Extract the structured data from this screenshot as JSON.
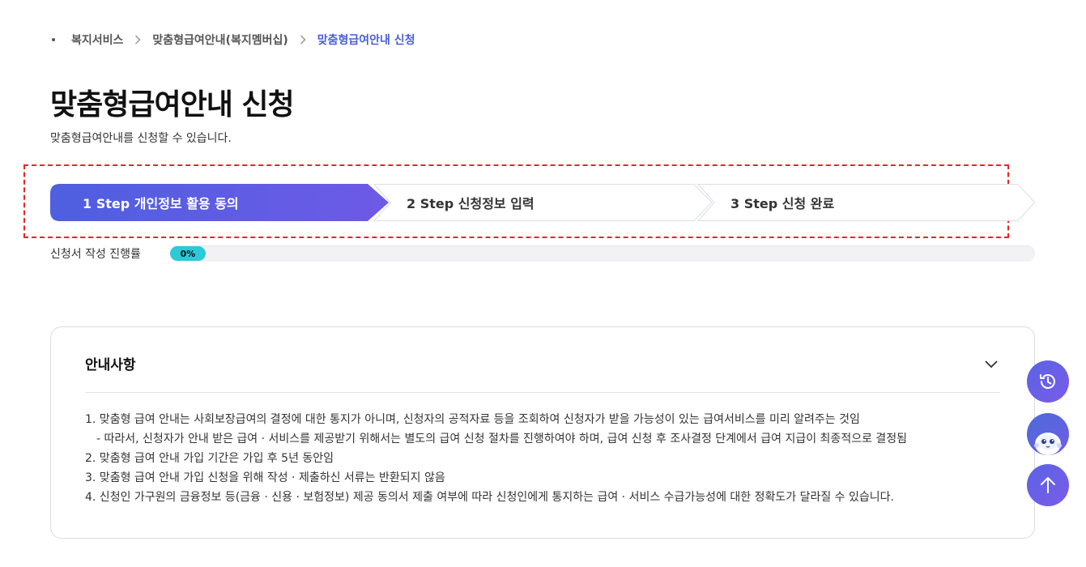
{
  "breadcrumb": {
    "items": [
      {
        "label": "복지서비스"
      },
      {
        "label": "맞춤형급여안내(복지멤버십)"
      },
      {
        "label": "맞춤형급여안내 신청"
      }
    ]
  },
  "page": {
    "title": "맞춤형급여안내 신청",
    "description": "맞춤형급여안내를 신청할 수 있습니다."
  },
  "steps": [
    {
      "label": "1 Step 개인정보 활용 동의",
      "state": "active"
    },
    {
      "label": "2 Step 신청정보 입력",
      "state": "inactive"
    },
    {
      "label": "3 Step 신청 완료",
      "state": "inactive"
    }
  ],
  "progress": {
    "label": "신청서 작성 진행률",
    "value_text": "0%",
    "value": 0
  },
  "notice": {
    "title": "안내사항",
    "toggle_icon": "chevron-down-icon",
    "lines": [
      "1. 맞춤형 급여 안내는 사회보장급여의 결정에 대한 통지가 아니며, 신청자의 공적자료 등을 조회하여 신청자가 받을 가능성이 있는 급여서비스를 미리 알려주는 것임",
      "- 따라서, 신청자가 안내 받은 급여 · 서비스를 제공받기 위해서는 별도의 급여 신청 절차를 진행하여야 하며, 급여 신청 후 조사결정 단계에서 급여 지급이 최종적으로 결정됨",
      "2. 맞춤형 급여 안내 가입 기간은 가입 후 5년 동안임",
      "3. 맞춤형 급여 안내 가입 신청을 위해 작성 · 제출하신 서류는 반환되지 않음",
      "4. 신청인 가구원의 금융정보 등(금융 · 신용 · 보험정보) 제공 동의서 제출 여부에 따라 신청인에게 통지하는 급여 · 서비스 수급가능성에 대한 정확도가 달라질 수 있습니다."
    ]
  },
  "floating_buttons": [
    {
      "icon": "history-icon"
    },
    {
      "icon": "chatbot-icon"
    },
    {
      "icon": "arrow-up-icon"
    }
  ],
  "colors": {
    "accent": "#4a5ed8",
    "step_active_start": "#4e5fe0",
    "step_active_end": "#6e5ae6",
    "progress": "#2cc9d9",
    "highlight_frame": "#e8262a"
  }
}
